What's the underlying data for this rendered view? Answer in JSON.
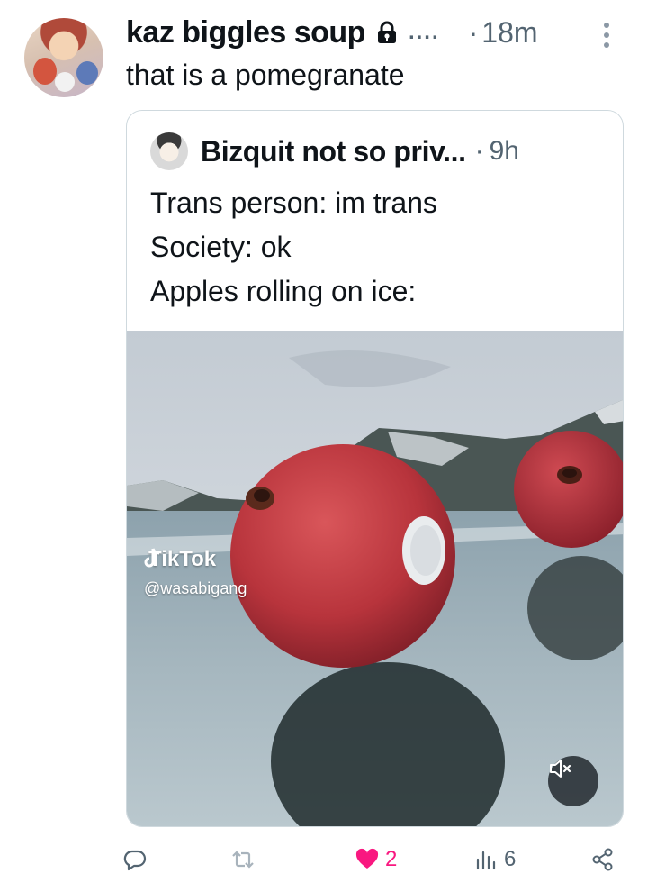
{
  "tweet": {
    "display_name": "kaz biggles soup",
    "name_overflow": "....",
    "dot": "·",
    "time": "18m",
    "text": "that is a pomegranate"
  },
  "quote": {
    "display_name": "Bizquit not so priv...",
    "dot": "·",
    "time": "9h",
    "lines": [
      "Trans person: im trans",
      "Society: ok",
      "Apples rolling on ice:"
    ],
    "media": {
      "watermark_brand": "TikTok",
      "watermark_handle": "@wasabigang"
    }
  },
  "actions": {
    "reply_icon": "reply-icon",
    "retweet_icon": "retweet-icon",
    "like_count": "2",
    "views_count": "6",
    "share_icon": "share-icon"
  },
  "colors": {
    "text": "#0f1419",
    "secondary": "#536471",
    "like": "#f91880",
    "border": "#cfd9de"
  }
}
